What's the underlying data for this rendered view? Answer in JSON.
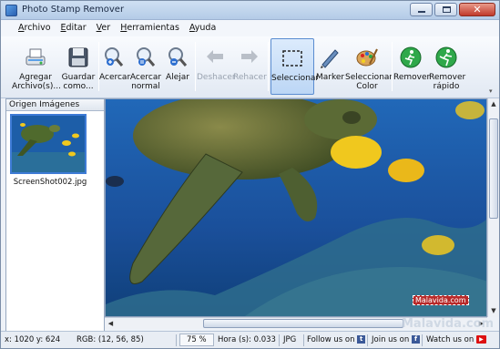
{
  "window": {
    "title": "Photo Stamp Remover"
  },
  "menu": [
    "Archivo",
    "Editar",
    "Ver",
    "Herramientas",
    "Ayuda"
  ],
  "toolbar": {
    "add_files": "Agregar\nArchivo(s)...",
    "save_as": "Guardar\ncomo...",
    "zoom_in": "Acercar",
    "zoom_normal": "Acercar\nnormal",
    "zoom_out": "Alejar",
    "undo": "Deshacer",
    "redo": "Rehacer",
    "select": "Seleccionar",
    "marker": "Marker",
    "select_color": "Seleccionar\nColor",
    "remove": "Remover",
    "remove_fast": "Remover\nrápido"
  },
  "left_panel": {
    "title": "Origen Imágenes",
    "file_name": "ScreenShot002.jpg"
  },
  "image": {
    "stamp_text": "Malavida.com"
  },
  "statusbar": {
    "coords": "x: 1020  y: 624",
    "rgb": "RGB: (12, 56, 85)",
    "zoom": "75 %",
    "time": "Hora (s): 0.033",
    "format": "JPG",
    "follow": "Follow us on",
    "join": "Join us on",
    "watch": "Watch us on"
  },
  "site_watermark": "Malavida.com",
  "colors": {
    "water": "#1a4f9a",
    "turtle": "#4b5d2a",
    "fish_yellow": "#f0c81e",
    "selection": "#5a8cd0"
  }
}
